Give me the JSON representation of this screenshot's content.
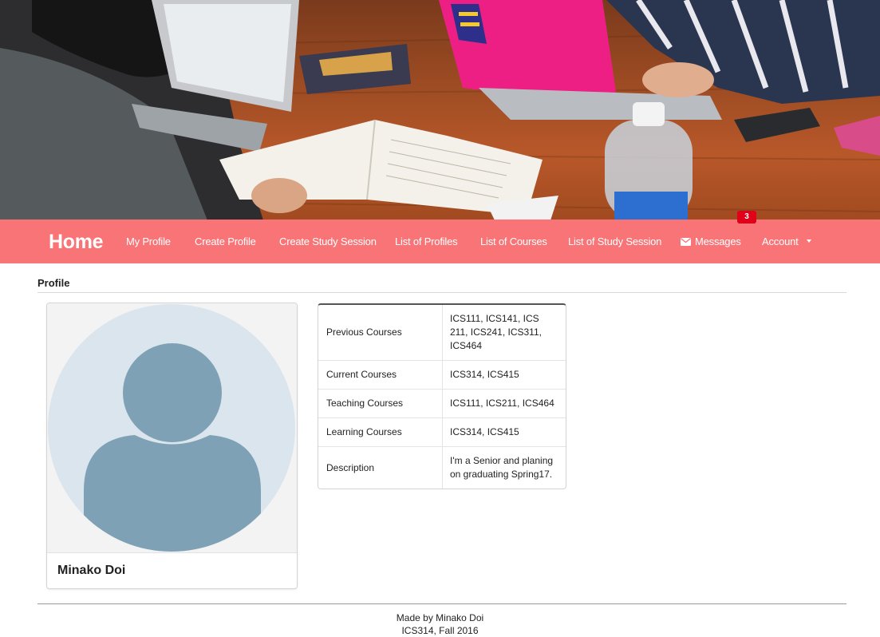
{
  "nav": {
    "brand": "Home",
    "items": [
      {
        "label": "My Profile"
      },
      {
        "label": "Create Profile"
      },
      {
        "label": "Create Study Session"
      },
      {
        "label": "List of Profiles"
      },
      {
        "label": "List of Courses"
      },
      {
        "label": "List of Study Session"
      },
      {
        "label": "Messages",
        "icon": "envelope-icon",
        "badge": "3"
      },
      {
        "label": "Account",
        "icon": "caret-down-icon"
      }
    ]
  },
  "page": {
    "section_title": "Profile"
  },
  "profile": {
    "name": "Minako Doi",
    "avatar_icon": "user-placeholder-icon",
    "rows": [
      {
        "label": "Previous Courses",
        "value": "ICS111, ICS141, ICS 211, ICS241, ICS311, ICS464"
      },
      {
        "label": "Current Courses",
        "value": "ICS314, ICS415"
      },
      {
        "label": "Teaching Courses",
        "value": "ICS111, ICS211, ICS464"
      },
      {
        "label": "Learning Courses",
        "value": "ICS314, ICS415"
      },
      {
        "label": "Description",
        "value": "I'm a Senior and planing on graduating Spring17."
      }
    ]
  },
  "footer": {
    "line1": "Made by Minako Doi",
    "line2": "ICS314, Fall 2016"
  },
  "colors": {
    "navbar": "#f87476",
    "badge": "#e0001a",
    "avatar_bg": "#dae5ed",
    "avatar_fg": "#7fa1b5"
  }
}
